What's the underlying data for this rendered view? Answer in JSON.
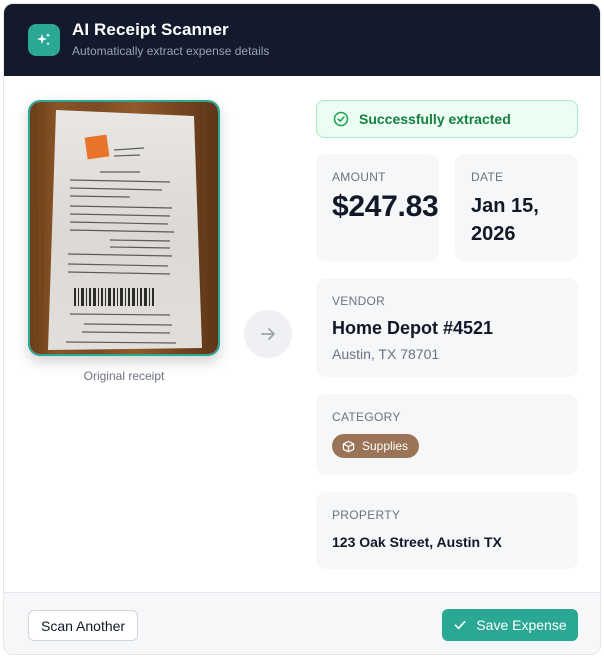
{
  "header": {
    "title": "AI Receipt Scanner",
    "subtitle": "Automatically extract expense details",
    "icon": "sparkles-icon"
  },
  "receipt": {
    "caption": "Original receipt"
  },
  "status": {
    "text": "Successfully extracted",
    "icon": "check-circle-icon"
  },
  "fields": {
    "amount": {
      "label": "AMOUNT",
      "value": "$247.83"
    },
    "date": {
      "label": "DATE",
      "value": "Jan 15, 2026"
    },
    "vendor": {
      "label": "VENDOR",
      "name": "Home Depot #4521",
      "address": "Austin, TX 78701"
    },
    "category": {
      "label": "CATEGORY",
      "value": "Supplies",
      "icon": "box-icon"
    },
    "property": {
      "label": "PROPERTY",
      "value": "123 Oak Street, Austin TX"
    }
  },
  "footer": {
    "scan_another_label": "Scan Another",
    "save_label": "Save Expense"
  },
  "colors": {
    "header_bg": "#121a2b",
    "accent": "#2aa893",
    "success_bg": "#ecfdf3",
    "success_text": "#15803d",
    "category_badge": "#9b7357"
  }
}
